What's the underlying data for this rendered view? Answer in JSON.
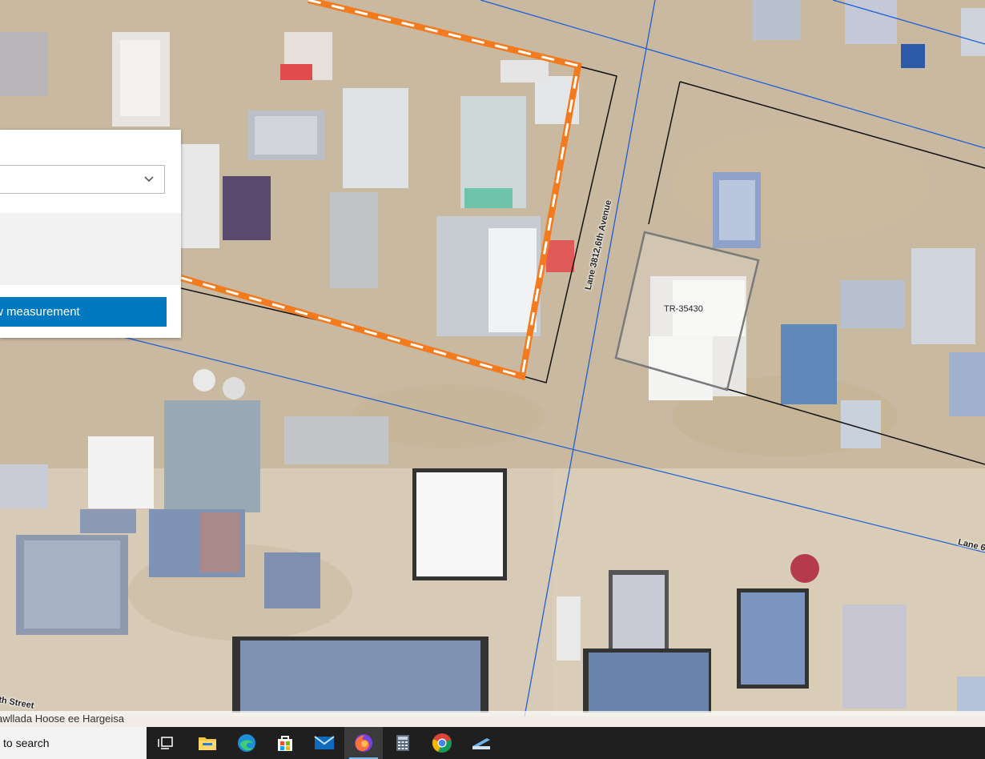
{
  "map": {
    "parcel_label": "TR-35430",
    "road_labels": {
      "avenue": "Lane 3812,6th Avenue",
      "lane_right": "Lane 6",
      "street_left": "th Street"
    },
    "colors": {
      "ground": "#cdbfa8",
      "selection_orange": "#f47a1e",
      "grid_blue": "#1f5fd6",
      "parcel_black": "#111111",
      "parcel_gray": "#7a7a7a"
    }
  },
  "panel": {
    "dropdown_value": "",
    "button_label": "w measurement"
  },
  "attribution": "awllada Hoose ee Hargeisa",
  "taskbar": {
    "search_text": "to search",
    "apps": [
      {
        "name": "task-view-icon"
      },
      {
        "name": "file-explorer-icon"
      },
      {
        "name": "edge-icon"
      },
      {
        "name": "store-icon"
      },
      {
        "name": "mail-icon"
      },
      {
        "name": "firefox-icon",
        "active": true
      },
      {
        "name": "calculator-icon"
      },
      {
        "name": "chrome-icon"
      },
      {
        "name": "scanner-icon"
      }
    ]
  }
}
